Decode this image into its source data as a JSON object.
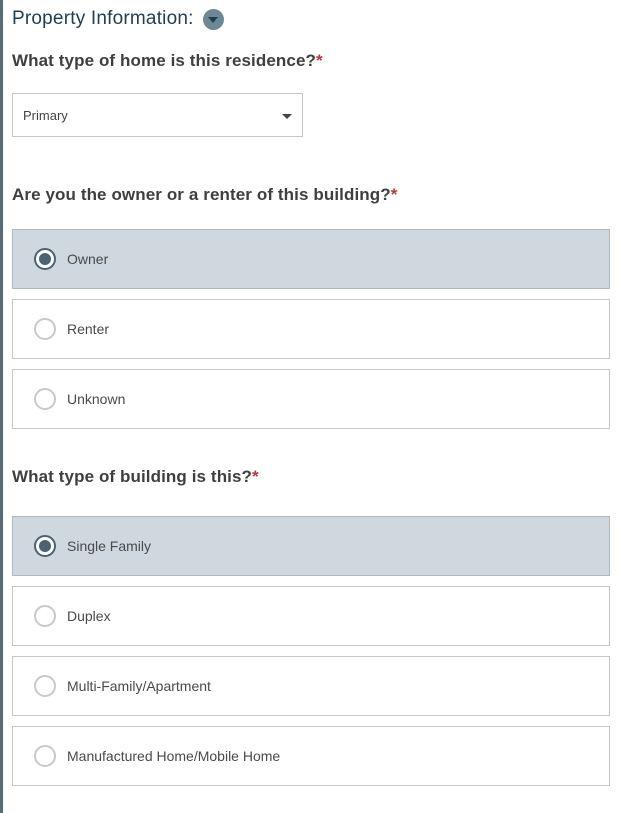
{
  "header": {
    "title": "Property Information:",
    "toggle_icon": "chevron-down-icon"
  },
  "q_home_type": {
    "question": "What type of home is this residence?",
    "required_mark": "*",
    "selected": "Primary"
  },
  "q_owner": {
    "question": "Are you the owner or a renter of this building?",
    "required_mark": "*",
    "options": [
      "Owner",
      "Renter",
      "Unknown"
    ],
    "selected": "Owner"
  },
  "q_building": {
    "question": "What type of building is this?",
    "required_mark": "*",
    "options": [
      "Single Family",
      "Duplex",
      "Multi-Family/Apartment",
      "Manufactured Home/Mobile Home"
    ],
    "selected": "Single Family"
  },
  "colors": {
    "accent": "#4a6372",
    "selected_bg": "#cfd8de",
    "required": "#b23a3a",
    "header_text": "#1f3f50"
  }
}
